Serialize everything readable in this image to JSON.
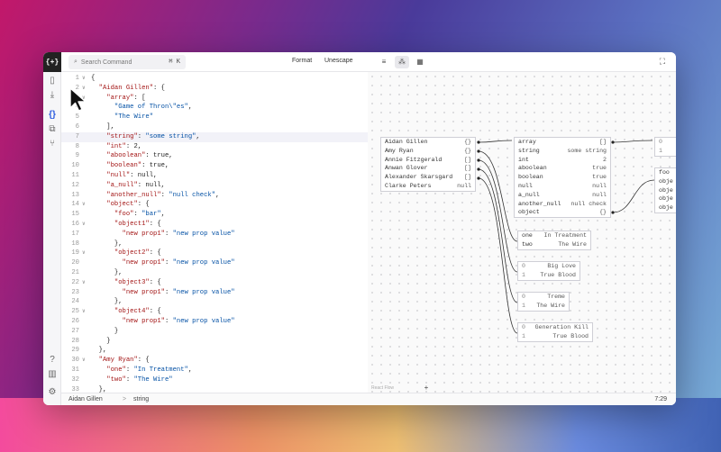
{
  "app": {
    "logo": "{+}"
  },
  "topbar": {
    "search_placeholder": "Search Command",
    "search_kbd": "⌘ K",
    "format": "Format",
    "unescape": "Unescape"
  },
  "editor": {
    "lines": [
      {
        "n": "1",
        "fold": "∨",
        "html": "<span class=\"p\">{</span>"
      },
      {
        "n": "2",
        "fold": "∨",
        "html": "  <span class=\"k\">\"Aidan Gillen\"</span><span class=\"p\">: {</span>"
      },
      {
        "n": "3",
        "fold": "∨",
        "html": "    <span class=\"k\">\"array\"</span><span class=\"p\">: [</span>"
      },
      {
        "n": "4",
        "fold": "",
        "html": "      <span class=\"s\">\"Game of Thron\\\"es\"</span><span class=\"p\">,</span>"
      },
      {
        "n": "5",
        "fold": "",
        "html": "      <span class=\"s\">\"The Wire\"</span>"
      },
      {
        "n": "6",
        "fold": "",
        "html": "    <span class=\"p\">],</span>"
      },
      {
        "n": "7",
        "fold": "",
        "html": "    <span class=\"k\">\"string\"</span><span class=\"p\">: </span><span class=\"s\">\"some string\"</span><span class=\"p\">,</span>",
        "hl": true
      },
      {
        "n": "8",
        "fold": "",
        "html": "    <span class=\"k\">\"int\"</span><span class=\"p\">: 2,</span>"
      },
      {
        "n": "9",
        "fold": "",
        "html": "    <span class=\"k\">\"aboolean\"</span><span class=\"p\">: true,</span>"
      },
      {
        "n": "10",
        "fold": "",
        "html": "    <span class=\"k\">\"boolean\"</span><span class=\"p\">: true,</span>"
      },
      {
        "n": "11",
        "fold": "",
        "html": "    <span class=\"k\">\"null\"</span><span class=\"p\">: null,</span>"
      },
      {
        "n": "12",
        "fold": "",
        "html": "    <span class=\"k\">\"a_null\"</span><span class=\"p\">: null,</span>"
      },
      {
        "n": "13",
        "fold": "",
        "html": "    <span class=\"k\">\"another_null\"</span><span class=\"p\">: </span><span class=\"s\">\"null check\"</span><span class=\"p\">,</span>"
      },
      {
        "n": "14",
        "fold": "∨",
        "html": "    <span class=\"k\">\"object\"</span><span class=\"p\">: {</span>"
      },
      {
        "n": "15",
        "fold": "",
        "html": "      <span class=\"k\">\"foo\"</span><span class=\"p\">: </span><span class=\"s\">\"bar\"</span><span class=\"p\">,</span>"
      },
      {
        "n": "16",
        "fold": "∨",
        "html": "      <span class=\"k\">\"object1\"</span><span class=\"p\">: {</span>"
      },
      {
        "n": "17",
        "fold": "",
        "html": "        <span class=\"k\">\"new prop1\"</span><span class=\"p\">: </span><span class=\"s\">\"new prop value\"</span>"
      },
      {
        "n": "18",
        "fold": "",
        "html": "      <span class=\"p\">},</span>"
      },
      {
        "n": "19",
        "fold": "∨",
        "html": "      <span class=\"k\">\"object2\"</span><span class=\"p\">: {</span>"
      },
      {
        "n": "20",
        "fold": "",
        "html": "        <span class=\"k\">\"new prop1\"</span><span class=\"p\">: </span><span class=\"s\">\"new prop value\"</span>"
      },
      {
        "n": "21",
        "fold": "",
        "html": "      <span class=\"p\">},</span>"
      },
      {
        "n": "22",
        "fold": "∨",
        "html": "      <span class=\"k\">\"object3\"</span><span class=\"p\">: {</span>"
      },
      {
        "n": "23",
        "fold": "",
        "html": "        <span class=\"k\">\"new prop1\"</span><span class=\"p\">: </span><span class=\"s\">\"new prop value\"</span>"
      },
      {
        "n": "24",
        "fold": "",
        "html": "      <span class=\"p\">},</span>"
      },
      {
        "n": "25",
        "fold": "∨",
        "html": "      <span class=\"k\">\"object4\"</span><span class=\"p\">: {</span>"
      },
      {
        "n": "26",
        "fold": "",
        "html": "        <span class=\"k\">\"new prop1\"</span><span class=\"p\">: </span><span class=\"s\">\"new prop value\"</span>"
      },
      {
        "n": "27",
        "fold": "",
        "html": "      <span class=\"p\">}</span>"
      },
      {
        "n": "28",
        "fold": "",
        "html": "    <span class=\"p\">}</span>"
      },
      {
        "n": "29",
        "fold": "",
        "html": "  <span class=\"p\">},</span>"
      },
      {
        "n": "30",
        "fold": "∨",
        "html": "  <span class=\"k\">\"Amy Ryan\"</span><span class=\"p\">: {</span>"
      },
      {
        "n": "31",
        "fold": "",
        "html": "    <span class=\"k\">\"one\"</span><span class=\"p\">: </span><span class=\"s\">\"In Treatment\"</span><span class=\"p\">,</span>"
      },
      {
        "n": "32",
        "fold": "",
        "html": "    <span class=\"k\">\"two\"</span><span class=\"p\">: </span><span class=\"s\">\"The Wire\"</span>"
      },
      {
        "n": "33",
        "fold": "",
        "html": "  <span class=\"p\">},</span>"
      }
    ]
  },
  "graph": {
    "root_rows": [
      {
        "k": "Aidan Gillen",
        "v": "{}"
      },
      {
        "k": "Amy Ryan",
        "v": "{}"
      },
      {
        "k": "Annie Fitzgerald",
        "v": "[]"
      },
      {
        "k": "Anwan Glover",
        "v": "[]"
      },
      {
        "k": "Alexander Skarsgard",
        "v": "[]"
      },
      {
        "k": "Clarke Peters",
        "v": "null"
      }
    ],
    "aidan_rows": [
      {
        "k": "array",
        "v": "[]"
      },
      {
        "k": "string",
        "v": "some string"
      },
      {
        "k": "int",
        "v": "2"
      },
      {
        "k": "aboolean",
        "v": "true"
      },
      {
        "k": "boolean",
        "v": "true"
      },
      {
        "k": "null",
        "v": "null"
      },
      {
        "k": "a_null",
        "v": "null"
      },
      {
        "k": "another_null",
        "v": "null check"
      },
      {
        "k": "object",
        "v": "{}"
      }
    ],
    "array_rows": [
      {
        "k": "0",
        "v": ""
      },
      {
        "k": "1",
        "v": ""
      }
    ],
    "object_rows": [
      {
        "k": "foo",
        "v": ""
      },
      {
        "k": "obje",
        "v": ""
      },
      {
        "k": "obje",
        "v": ""
      },
      {
        "k": "obje",
        "v": ""
      },
      {
        "k": "obje",
        "v": ""
      }
    ],
    "amy_rows": [
      {
        "k": "one",
        "v": "In Treatment"
      },
      {
        "k": "two",
        "v": "The Wire"
      }
    ],
    "annie_rows": [
      {
        "k": "0",
        "v": "Big Love"
      },
      {
        "k": "1",
        "v": "True Blood"
      }
    ],
    "anwan_rows": [
      {
        "k": "0",
        "v": "Treme"
      },
      {
        "k": "1",
        "v": "The Wire"
      }
    ],
    "alex_rows": [
      {
        "k": "0",
        "v": "Generation Kill"
      },
      {
        "k": "1",
        "v": "True Blood"
      }
    ],
    "zoom_in": "+",
    "zoom_out": "−",
    "fit": "⛶",
    "hint": "React Flow"
  },
  "statusbar": {
    "crumb1": "Aidan Gillen",
    "sep": ">",
    "crumb2": "string",
    "pos": "7:29"
  }
}
